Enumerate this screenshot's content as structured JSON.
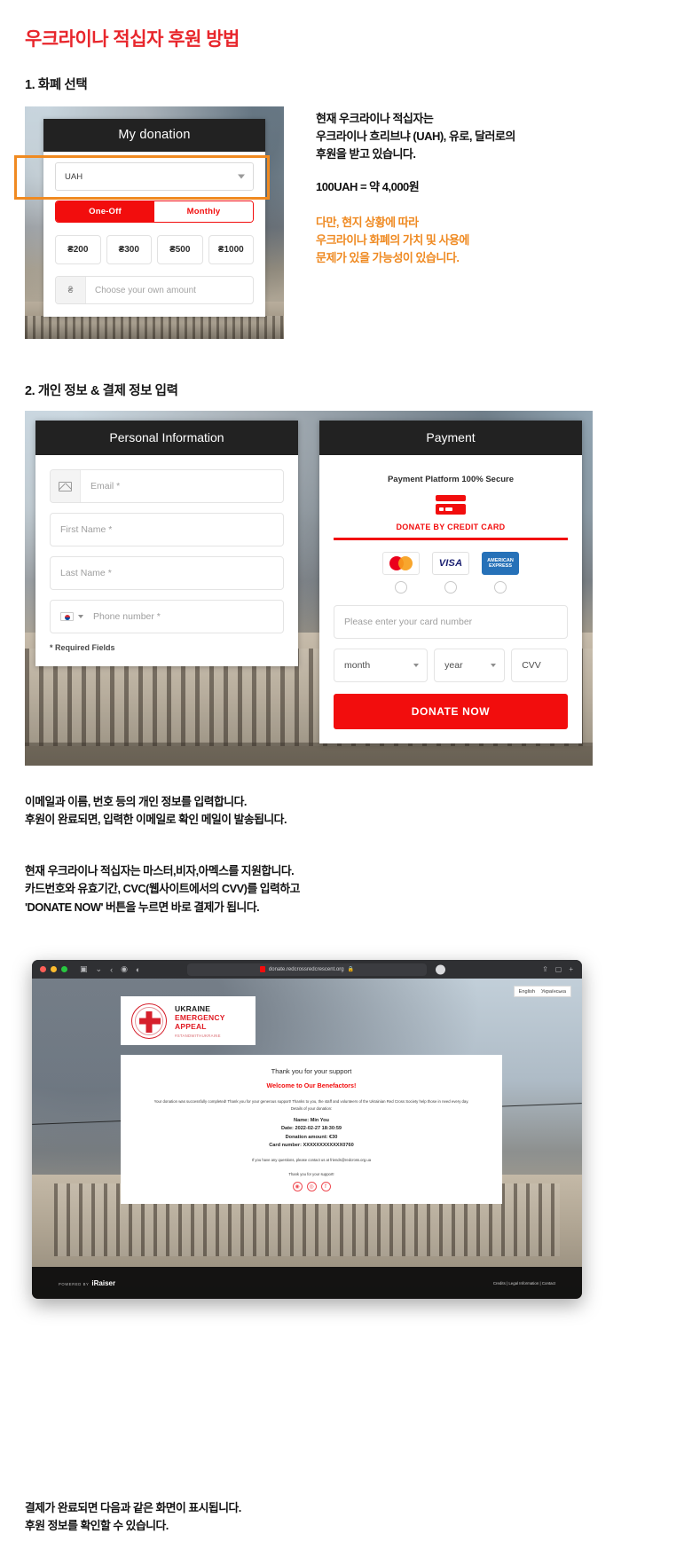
{
  "page": {
    "title": "우크라이나 적십자 후원 방법"
  },
  "step1": {
    "heading": "1. 화폐 선택",
    "widget": {
      "card_title": "My donation",
      "currency_value": "UAH",
      "frequency": {
        "one_off": "One-Off",
        "monthly": "Monthly",
        "selected": "One-Off"
      },
      "amounts": [
        "₴200",
        "₴300",
        "₴500",
        "₴1000"
      ],
      "own_amount_symbol": "₴",
      "own_amount_placeholder": "Choose your own amount"
    },
    "notes": {
      "line1": "현재 우크라이나 적십자는",
      "line2": "우크라이나 흐리브냐 (UAH), 유로, 달러로의",
      "line3": "후원을 받고 있습니다.",
      "rate": "100UAH = 약 4,000원",
      "warn1": "다만, 현지 상황에 따라",
      "warn2": "우크라이나 화폐의 가치 및 사용에",
      "warn3": "문제가 있을 가능성이 있습니다."
    }
  },
  "step2": {
    "heading": "2. 개인 정보 & 결제 정보 입력",
    "personal": {
      "card_title": "Personal Information",
      "email_placeholder": "Email *",
      "first_name_placeholder": "First Name *",
      "last_name_placeholder": "Last Name *",
      "phone_placeholder": "Phone number *",
      "required_note": "* Required Fields"
    },
    "payment": {
      "card_title": "Payment",
      "secure_text": "Payment Platform 100% Secure",
      "donate_by": "DONATE BY CREDIT CARD",
      "brands": [
        "MasterCard",
        "VISA",
        "AMERICAN EXPRESS"
      ],
      "amex_line1": "AMERICAN",
      "amex_line2": "EXPRESS",
      "card_number_placeholder": "Please enter your card number",
      "month_value": "month",
      "year_value": "year",
      "cvv_placeholder": "CVV",
      "donate_button": "DONATE NOW"
    },
    "notes": {
      "p1_line1": "이메일과 이름, 번호 등의 개인 정보를 입력합니다.",
      "p1_line2": "후원이 완료되면, 입력한 이메일로 확인 메일이 발송됩니다.",
      "p2_line1": "현재 우크라이나 적십자는 마스터,비자,아멕스를 지원합니다.",
      "p2_line2": "카드번호와 유효기간, CVC(웹사이트에서의 CVV)를 입력하고",
      "p2_line3": "'DONATE NOW' 버튼을 누르면 바로 결제가 됩니다."
    }
  },
  "step3": {
    "browser": {
      "url": "donate.redcrossredcrescent.org",
      "lang_en": "English",
      "lang_uk": "Українська",
      "logo": {
        "line1": "UKRAINE",
        "line2": "EMERGENCY APPEAL",
        "hashtag": "#STANDWITHUKRAINE"
      },
      "thanks": {
        "title": "Thank you for your support",
        "subtitle": "Welcome to Our Benefactors!",
        "body": "Your donation was successfully completed! Thank you for your generous support! Thanks to you, the staff and volunteers of the Ukrainian Red Cross Society help those in need every day.",
        "details_label": "Details of your donation:",
        "name": "Name: Min You",
        "date": "Date: 2022-02-27 18:30:59",
        "amount": "Donation amount: €30",
        "card": "Card number: XXXXXXXXXXXX0760",
        "contact": "If you have any questions, please contact us at friends@redcross.org.ua",
        "contact_email": "friends@redcross.org.ua",
        "thanks_again": "Thank you for your support!"
      },
      "footer": {
        "powered_label": "POWERED BY",
        "powered_brand": "iRaiser",
        "links": "Credits | Legal Information | Contact"
      }
    },
    "notes": {
      "line1": "결제가 완료되면 다음과 같은 화면이 표시됩니다.",
      "line2": "후원 정보를 확인할 수 있습니다."
    }
  },
  "colors": {
    "brand_red": "#e8262c",
    "button_red": "#f20d0d",
    "highlight_orange": "#f08a21",
    "note_orange": "#ef8a22",
    "header_dark": "#222222"
  }
}
